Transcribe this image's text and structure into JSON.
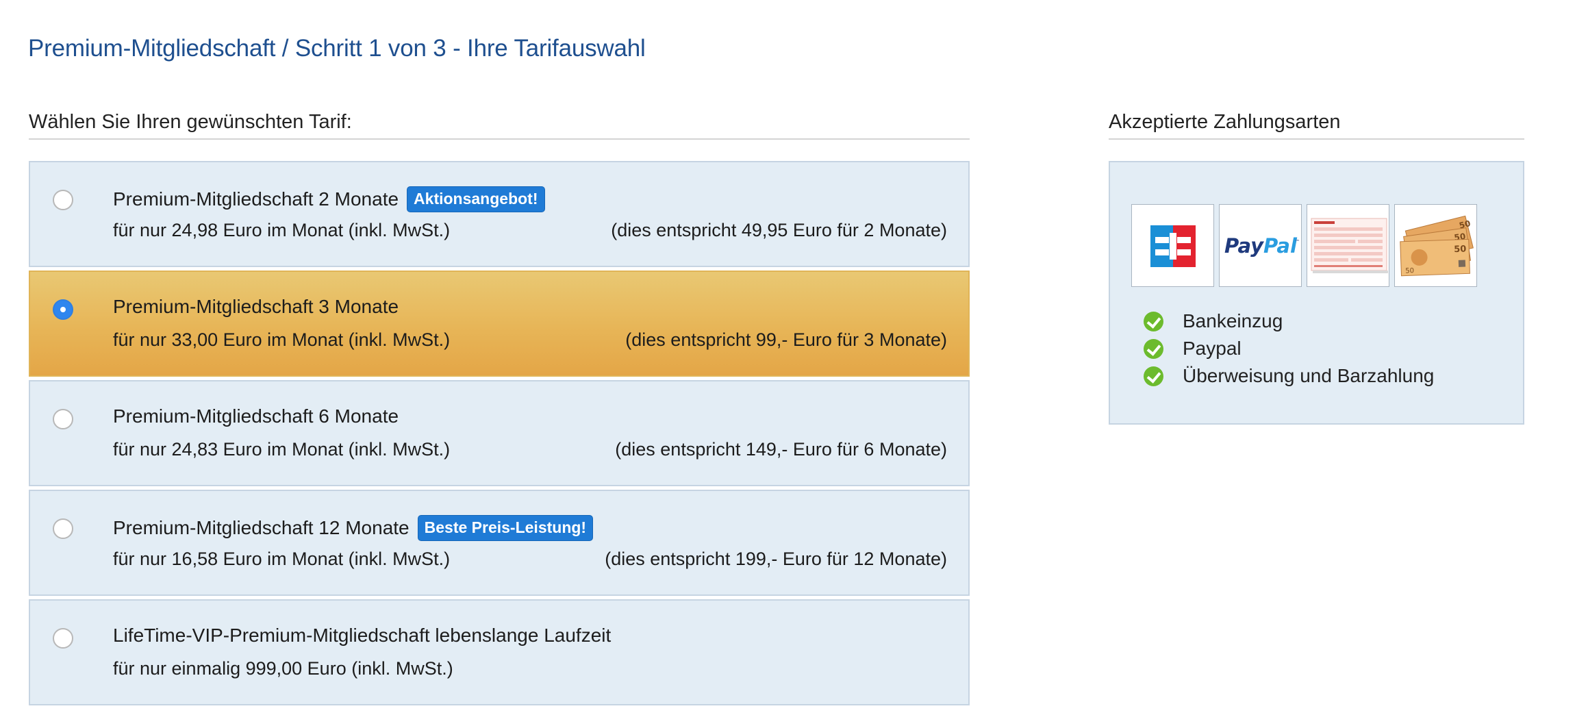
{
  "page": {
    "title": "Premium-Mitgliedschaft / Schritt 1 von 3 - Ihre Tarifauswahl"
  },
  "tariff_section": {
    "heading": "Wählen Sie Ihren gewünschten Tarif:",
    "selected_index": 1,
    "options": [
      {
        "title": "Premium-Mitgliedschaft 2 Monate",
        "badge": "Aktionsangebot!",
        "price": "für nur 24,98 Euro im Monat (inkl. MwSt.)",
        "total": "(dies entspricht 49,95 Euro für 2 Monate)",
        "selected": false
      },
      {
        "title": "Premium-Mitgliedschaft 3 Monate",
        "badge": "",
        "price": "für nur 33,00 Euro im Monat (inkl. MwSt.)",
        "total": "(dies entspricht 99,- Euro für 3 Monate)",
        "selected": true
      },
      {
        "title": "Premium-Mitgliedschaft 6 Monate",
        "badge": "",
        "price": "für nur 24,83 Euro im Monat (inkl. MwSt.)",
        "total": "(dies entspricht 149,- Euro für 6 Monate)",
        "selected": false
      },
      {
        "title": "Premium-Mitgliedschaft 12 Monate",
        "badge": "Beste Preis-Leistung!",
        "price": "für nur 16,58 Euro im Monat (inkl. MwSt.)",
        "total": "(dies entspricht 199,- Euro für 12 Monate)",
        "selected": false
      },
      {
        "title": "LifeTime-VIP-Premium-Mitgliedschaft lebenslange Laufzeit",
        "badge": "",
        "price": "für nur einmalig 999,00 Euro (inkl. MwSt.)",
        "total": "",
        "selected": false
      }
    ]
  },
  "payment_section": {
    "heading": "Akzeptierte Zahlungsarten",
    "logos": [
      {
        "name": "ec-logo-icon",
        "text": "EC"
      },
      {
        "name": "paypal-logo-icon",
        "text": "PayPal"
      },
      {
        "name": "bank-transfer-form-icon",
        "text": ""
      },
      {
        "name": "euro-banknotes-icon",
        "text": ""
      }
    ],
    "methods": [
      "Bankeinzug",
      "Paypal",
      "Überweisung und Barzahlung"
    ]
  },
  "colors": {
    "title_blue": "#1e4f8f",
    "tile_bg": "#e3edf5",
    "selected_gold": "#e7b557",
    "badge_blue": "#1f7bd6",
    "check_green": "#6cbb2d"
  }
}
